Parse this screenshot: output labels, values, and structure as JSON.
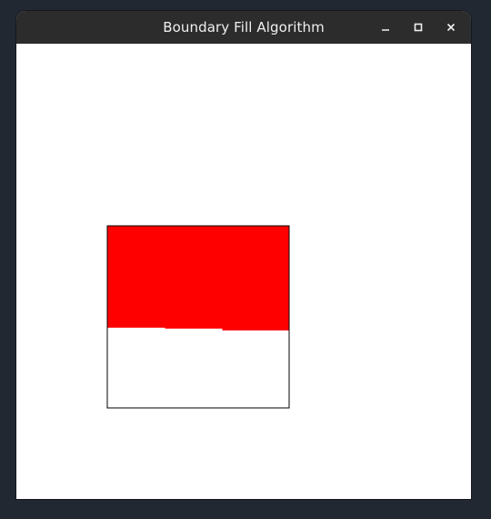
{
  "window": {
    "title": "Boundary Fill Algorithm",
    "controls": {
      "minimize": "minimize-icon",
      "maximize": "maximize-icon",
      "close": "close-icon"
    }
  },
  "drawing": {
    "boundary_color": "#000000",
    "fill_color": "#ff0000",
    "background_color": "#ffffff",
    "fill_progress_fraction": 0.57
  }
}
